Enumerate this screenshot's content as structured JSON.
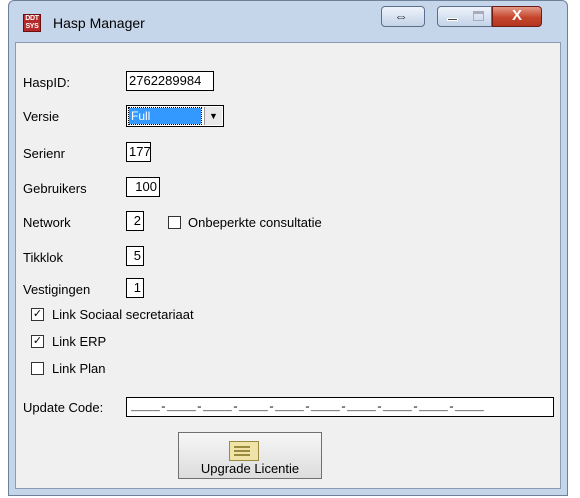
{
  "window": {
    "title": "Hasp Manager",
    "icon_text_top": "DDT",
    "icon_text_bottom": "SYS",
    "buttons": {
      "resize_glyph": "⇔",
      "close_glyph": "X"
    }
  },
  "form": {
    "haspid": {
      "label": "HaspID:",
      "value": "2762289984"
    },
    "versie": {
      "label": "Versie",
      "value": "Full"
    },
    "serienr": {
      "label": "Serienr",
      "value": "177"
    },
    "gebruikers": {
      "label": "Gebruikers",
      "value": "100"
    },
    "network": {
      "label": "Network",
      "value": "2"
    },
    "onbeperkte": {
      "label": "Onbeperkte consultatie",
      "checked": false
    },
    "tikklok": {
      "label": "Tikklok",
      "value": "5"
    },
    "vestigingen": {
      "label": "Vestigingen",
      "value": "1"
    },
    "link_sociaal": {
      "label": "Link Sociaal secretariaat",
      "checked": true
    },
    "link_erp": {
      "label": "Link ERP",
      "checked": true
    },
    "link_plan": {
      "label": "Link Plan",
      "checked": false
    },
    "update_code": {
      "label": "Update Code:",
      "value": "____-____-____-____-____-____-____-____-____-____"
    },
    "upgrade_button": {
      "label": "Upgrade Licentie"
    }
  },
  "colors": {
    "title_bar": "#c6d6ea",
    "selection": "#3399ff",
    "close_button": "#c5452b"
  },
  "icons": {
    "app": "app-icon",
    "resize": "resize-icon",
    "minimize": "minimize-icon",
    "maximize": "maximize-icon",
    "close": "close-icon",
    "dropdown": "chevron-down-icon",
    "upgrade": "certificate-icon"
  }
}
